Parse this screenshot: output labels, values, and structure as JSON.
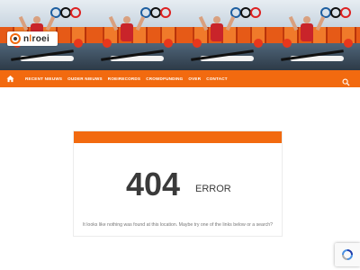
{
  "brand": {
    "logo_prefix": "n",
    "logo_o": "l",
    "logo_rest": "roei",
    "accent_color": "#f26a0f"
  },
  "nav": {
    "home_icon": "home-icon",
    "items": [
      {
        "label": "Recent nieuws"
      },
      {
        "label": "Ouder nieuws"
      },
      {
        "label": "Roeirecords"
      },
      {
        "label": "Crowdfunding"
      },
      {
        "label": "Over"
      },
      {
        "label": "Contact"
      }
    ],
    "search_icon": "search-icon"
  },
  "error": {
    "code": "404",
    "label": "ERROR",
    "message": "It looks like nothing was found at this location. Maybe try one of the links below or a search?"
  },
  "widgets": {
    "recaptcha_icon": "recaptcha-icon"
  }
}
